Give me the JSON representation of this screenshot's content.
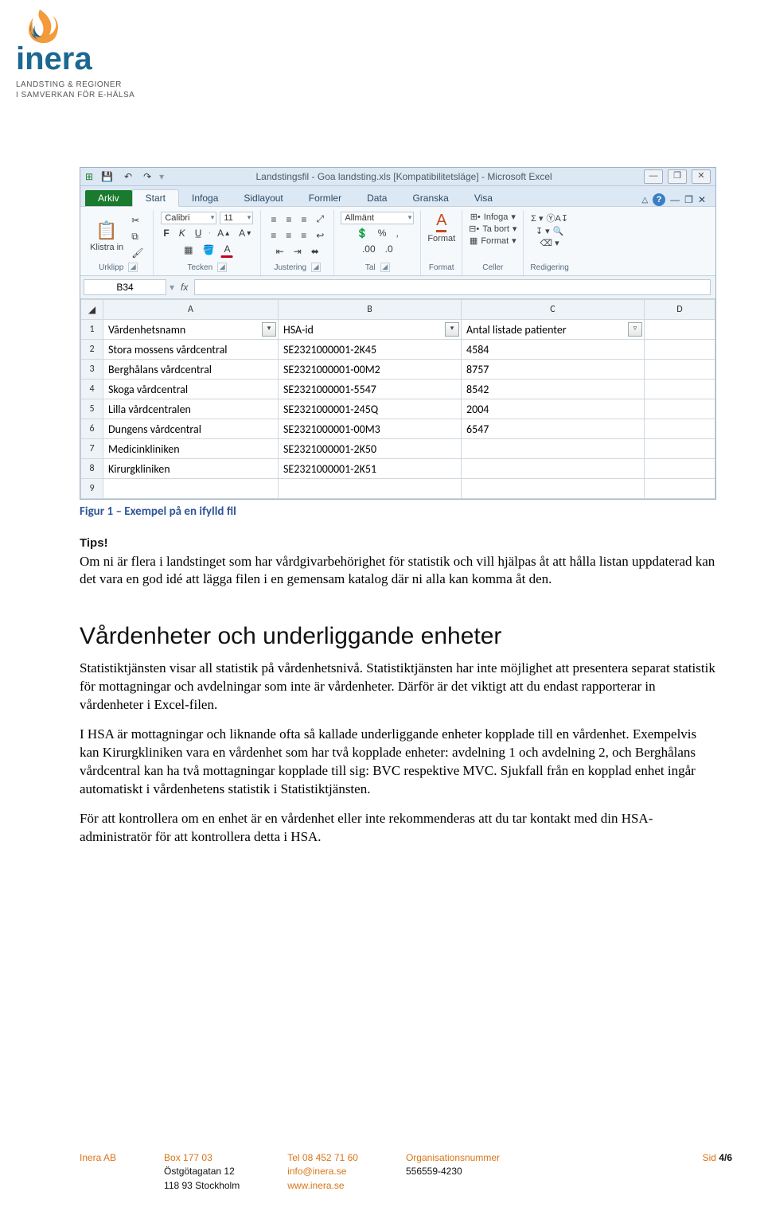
{
  "logo": {
    "name": "inera",
    "tagline1": "LANDSTING & REGIONER",
    "tagline2": "I SAMVERKAN FÖR E-HÄLSA"
  },
  "excel": {
    "title": "Landstingsfil - Goa landsting.xls [Kompatibilitetsläge] - Microsoft Excel",
    "file_tab": "Arkiv",
    "tabs": [
      "Start",
      "Infoga",
      "Sidlayout",
      "Formler",
      "Data",
      "Granska",
      "Visa"
    ],
    "active_tab": "Start",
    "groups": {
      "clipboard": "Urklipp",
      "paste": "Klistra in",
      "font": "Tecken",
      "font_name": "Calibri",
      "font_size": "11",
      "align": "Justering",
      "number": "Tal",
      "number_format": "Allmänt",
      "styles": "Format",
      "cells": "Celler",
      "cells_insert": "Infoga",
      "cells_delete": "Ta bort",
      "cells_format": "Format",
      "editing": "Redigering"
    },
    "namebox": "B34",
    "fx": "fx",
    "columns": [
      "A",
      "B",
      "C",
      "D"
    ],
    "headers": [
      "Vårdenhetsnamn",
      "HSA-id",
      "Antal listade patienter"
    ],
    "rows": [
      {
        "n": "2",
        "a": "Stora mossens vårdcentral",
        "b": "SE2321000001-2K45",
        "c": "4584"
      },
      {
        "n": "3",
        "a": "Berghålans vårdcentral",
        "b": "SE2321000001-00M2",
        "c": "8757"
      },
      {
        "n": "4",
        "a": "Skoga vårdcentral",
        "b": "SE2321000001-5547",
        "c": "8542"
      },
      {
        "n": "5",
        "a": "Lilla vårdcentralen",
        "b": "SE2321000001-245Q",
        "c": "2004"
      },
      {
        "n": "6",
        "a": "Dungens vårdcentral",
        "b": "SE2321000001-00M3",
        "c": "6547"
      },
      {
        "n": "7",
        "a": "Medicinkliniken",
        "b": "SE2321000001-2K50",
        "c": ""
      },
      {
        "n": "8",
        "a": "Kirurgkliniken",
        "b": "SE2321000001-2K51",
        "c": ""
      },
      {
        "n": "9",
        "a": "",
        "b": "",
        "c": ""
      }
    ]
  },
  "figure_caption": "Figur 1 – Exempel på en ifylld fil",
  "tips_heading": "Tips!",
  "tips_text": "Om ni är flera i landstinget som har vårdgivarbehörighet för statistik och vill hjälpas åt att hålla listan uppdaterad kan det vara en god idé att lägga filen i en gemensam katalog där ni alla kan komma åt den.",
  "section_heading": "Vårdenheter och underliggande enheter",
  "body": {
    "p1": "Statistiktjänsten visar all statistik på vårdenhetsnivå. Statistiktjänsten har inte möjlighet att presentera separat statistik för mottagningar och avdelningar som inte är vårdenheter. Därför är det viktigt att du endast rapporterar in vårdenheter i Excel-filen.",
    "p2": "I HSA är mottagningar och liknande ofta så kallade underliggande enheter kopplade till en vårdenhet. Exempelvis kan Kirurgkliniken vara en vårdenhet som har två kopplade enheter: avdelning 1 och avdelning 2, och Berghålans vårdcentral kan ha två mottagningar kopplade till sig: BVC respektive MVC. Sjukfall från en kopplad enhet ingår automatiskt i vårdenhetens statistik i Statistiktjänsten.",
    "p3": "För att kontrollera om en enhet är en vårdenhet eller inte rekommenderas att du tar kontakt med din HSA-administratör för att kontrollera detta i HSA."
  },
  "footer": {
    "company": "Inera AB",
    "addr1": "Box 177 03",
    "addr2": "Östgötagatan 12",
    "addr3": "118 93 Stockholm",
    "tel_label": "Tel",
    "tel": "08 452 71 60",
    "email": "info@inera.se",
    "web": "www.inera.se",
    "org_label": "Organisationsnummer",
    "org": "556559-4230",
    "page_label": "Sid",
    "page": "4/6"
  }
}
